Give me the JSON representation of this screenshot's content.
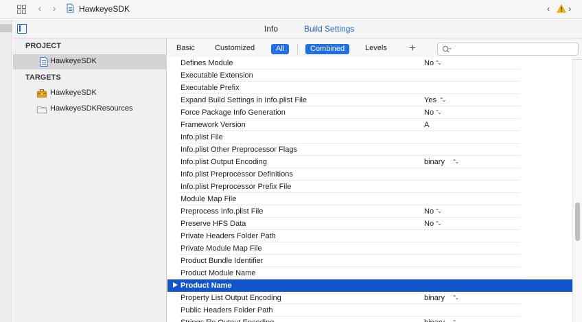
{
  "jumpbar": {
    "title": "HawkeyeSDK",
    "back_glyph": "‹",
    "forward_glyph": "›",
    "issues_prev_glyph": "‹",
    "issues_next_glyph": "›",
    "icons": [
      "grid-icon",
      "file-icon",
      "warning-icon"
    ],
    "warning_color": "#f5b400"
  },
  "tabs": {
    "info": "Info",
    "build_settings": "Build Settings",
    "active": "Build Settings",
    "accent": "#1f64d4"
  },
  "sidebar": {
    "project_header": "PROJECT",
    "project_item": "HawkeyeSDK",
    "targets_header": "TARGETS",
    "targets": [
      {
        "label": "HawkeyeSDK",
        "icon": "toolbox-icon"
      },
      {
        "label": "HawkeyeSDKResources",
        "icon": "bundle-icon"
      }
    ]
  },
  "filter": {
    "basic": "Basic",
    "customized": "Customized",
    "all": "All",
    "combined": "Combined",
    "levels": "Levels",
    "add": "+",
    "search_placeholder": "",
    "selected_color": "#1f6fe6"
  },
  "settings": [
    {
      "name": "Defines Module",
      "value": "No",
      "popup": true
    },
    {
      "name": "Executable Extension",
      "value": "",
      "popup": false
    },
    {
      "name": "Executable Prefix",
      "value": "",
      "popup": false
    },
    {
      "name": "Expand Build Settings in Info.plist File",
      "value": "Yes",
      "popup": true
    },
    {
      "name": "Force Package Info Generation",
      "value": "No",
      "popup": true
    },
    {
      "name": "Framework Version",
      "value": "A",
      "popup": false
    },
    {
      "name": "Info.plist File",
      "value": "",
      "popup": false
    },
    {
      "name": "Info.plist Other Preprocessor Flags",
      "value": "",
      "popup": false
    },
    {
      "name": "Info.plist Output Encoding",
      "value": "binary",
      "popup": true
    },
    {
      "name": "Info.plist Preprocessor Definitions",
      "value": "",
      "popup": false
    },
    {
      "name": "Info.plist Preprocessor Prefix File",
      "value": "",
      "popup": false
    },
    {
      "name": "Module Map File",
      "value": "",
      "popup": false
    },
    {
      "name": "Preprocess Info.plist File",
      "value": "No",
      "popup": true
    },
    {
      "name": "Preserve HFS Data",
      "value": "No",
      "popup": true
    },
    {
      "name": "Private Headers Folder Path",
      "value": "",
      "popup": false
    },
    {
      "name": "Private Module Map File",
      "value": "",
      "popup": false
    },
    {
      "name": "Product Bundle Identifier",
      "value": "",
      "popup": false
    },
    {
      "name": "Product Module Name",
      "value": "",
      "popup": false
    },
    {
      "name": "Product Name",
      "value": "",
      "popup": false,
      "selected": true
    },
    {
      "name": "Property List Output Encoding",
      "value": "binary",
      "popup": true
    },
    {
      "name": "Public Headers Folder Path",
      "value": "",
      "popup": false
    },
    {
      "name": "Strings file Output Encoding",
      "value": "binary",
      "popup": true
    }
  ],
  "selection_color": "#1154cc",
  "scroll": {
    "position_fraction": 0.62
  }
}
